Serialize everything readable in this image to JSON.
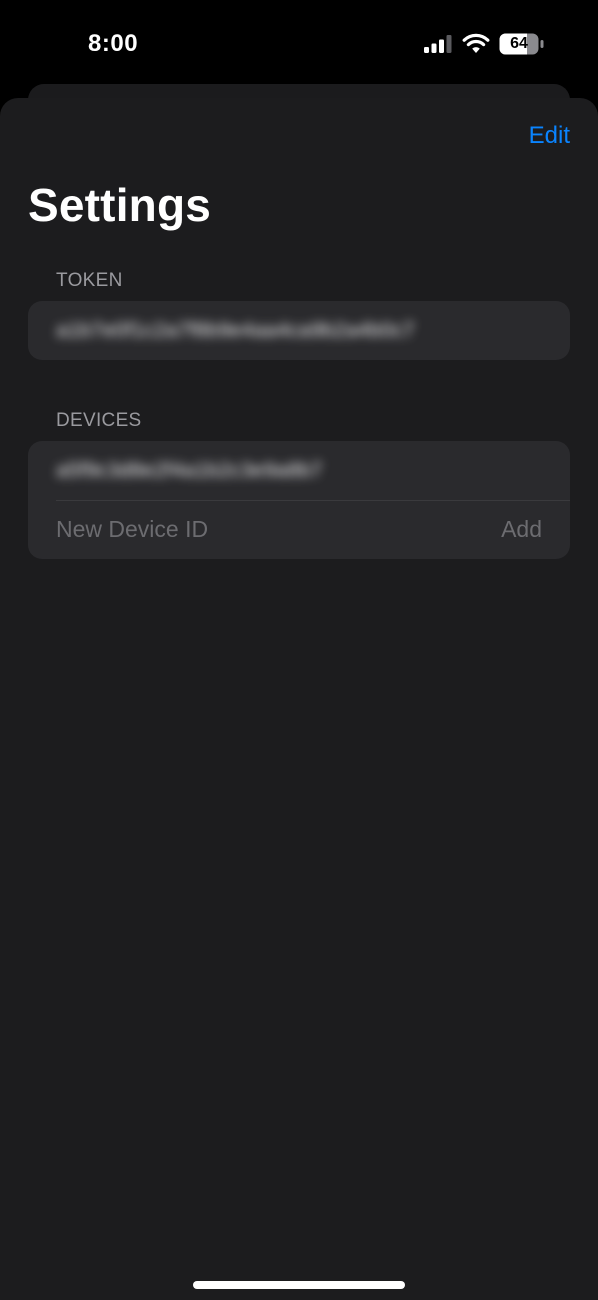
{
  "status_bar": {
    "time": "8:00",
    "battery_level": "64",
    "icons": [
      "signal-icon",
      "wifi-icon",
      "battery-icon"
    ]
  },
  "header": {
    "edit_label": "Edit",
    "title": "Settings"
  },
  "token_section": {
    "header": "TOKEN",
    "value": "a1b7e0f1c2a7f8b9e4aa4ca9b2a4b0c7"
  },
  "devices_section": {
    "header": "DEVICES",
    "devices": [
      "a5f9c3d8e2f4a1b2c3e9a8b7"
    ],
    "new_device_placeholder": "New Device ID",
    "add_label": "Add"
  },
  "colors": {
    "accent": "#0a84ff",
    "background": "#1c1c1e",
    "group_background": "#2a2a2d",
    "secondary_text": "#9a9a9f",
    "placeholder_text": "#6c6c70"
  }
}
